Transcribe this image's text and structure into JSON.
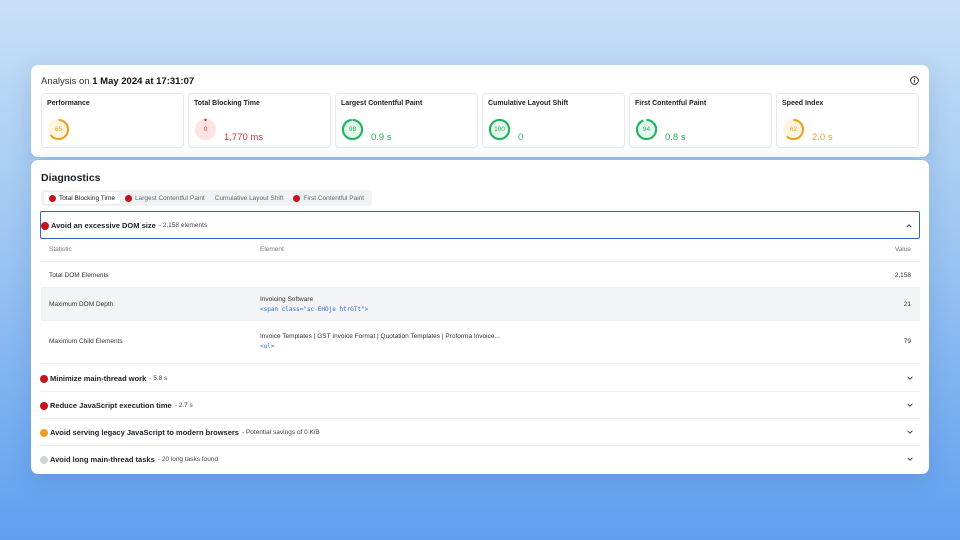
{
  "header": {
    "analysis_prefix": "Analysis on",
    "analysis_date": "1 May 2024 at 17:31:07",
    "info_icon": "info-icon"
  },
  "metrics": [
    {
      "title": "Performance",
      "score": "65",
      "value": "",
      "status": "average",
      "color": "#f0a020",
      "bg": "#fff4e0",
      "fill": 0.65
    },
    {
      "title": "Total Blocking Time",
      "score": "0",
      "value": "1,770 ms",
      "status": "fail",
      "color": "#d9323a",
      "bg": "#fde3e4",
      "fill": 0.0
    },
    {
      "title": "Largest Contentful Paint",
      "score": "98",
      "value": "0.9 s",
      "status": "pass",
      "color": "#22b35e",
      "bg": "#e4f7ec",
      "fill": 0.98
    },
    {
      "title": "Cumulative Layout Shift",
      "score": "100",
      "value": "0",
      "status": "pass",
      "color": "#22b35e",
      "bg": "#e4f7ec",
      "fill": 1.0
    },
    {
      "title": "First Contentful Paint",
      "score": "94",
      "value": "0.8 s",
      "status": "pass",
      "color": "#22b35e",
      "bg": "#e4f7ec",
      "fill": 0.94
    },
    {
      "title": "Speed Index",
      "score": "62",
      "value": "2.0 s",
      "status": "average",
      "color": "#f0a020",
      "bg": "#fff4e0",
      "fill": 0.62
    }
  ],
  "diagnostics": {
    "title": "Diagnostics",
    "filters": [
      {
        "label": "Total Blocking Time",
        "dot": "#c4141b",
        "active": true
      },
      {
        "label": "Largest Contentful Paint",
        "dot": "#c4141b",
        "active": false
      },
      {
        "label": "Cumulative Layout Shift",
        "dot": "",
        "active": false
      },
      {
        "label": "First Contentful Paint",
        "dot": "#c4141b",
        "active": false
      }
    ],
    "open_audit": {
      "title": "Avoid an excessive DOM size",
      "detail": "- 2,158 elements",
      "dot": "#c4141b",
      "table": {
        "headers": {
          "statistic": "Statistic",
          "element": "Element",
          "value": "Value"
        },
        "rows": [
          {
            "statistic": "Total DOM Elements",
            "element_text": "",
            "element_code": "",
            "value": "2,158"
          },
          {
            "statistic": "Maximum DOM Depth",
            "element_text": "Invoicing Software",
            "element_code": "<span class=\"sc-EHOje htrGTt\">",
            "value": "21"
          },
          {
            "statistic": "Maximum Child Elements",
            "element_text": "Invoice Templates | GST Invoice Format | Quotation Templates | Proforma Invoice...",
            "element_code": "<ul>",
            "value": "79"
          }
        ]
      }
    },
    "audits": [
      {
        "title": "Minimize main-thread work",
        "detail": "- 5.8 s",
        "dot": "#c4141b"
      },
      {
        "title": "Reduce JavaScript execution time",
        "detail": "- 2.7 s",
        "dot": "#c4141b"
      },
      {
        "title": "Avoid serving legacy JavaScript to modern browsers",
        "detail": "- Potential savings of 0 KiB",
        "dot": "#f0a020"
      },
      {
        "title": "Avoid long main-thread tasks",
        "detail": "- 20 long tasks found",
        "dot": "#cfd2d6"
      }
    ]
  }
}
